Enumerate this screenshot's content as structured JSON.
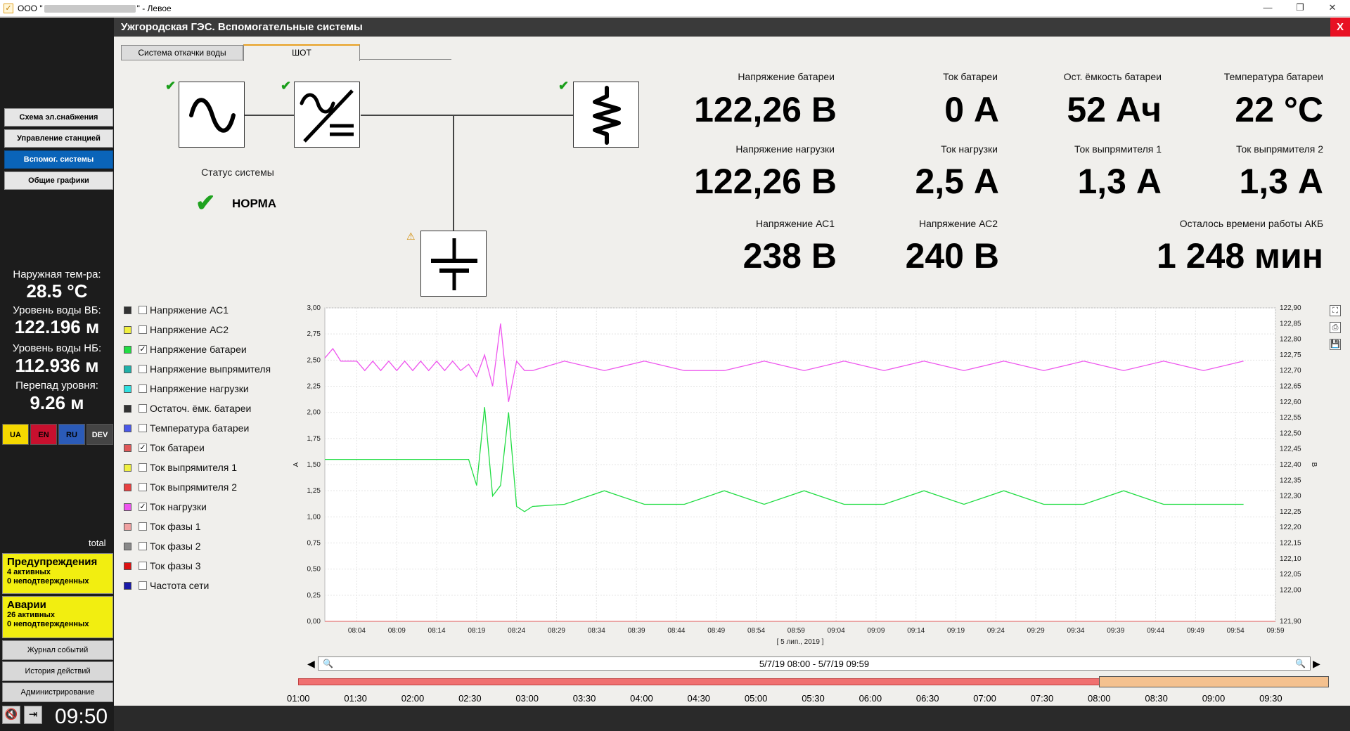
{
  "window": {
    "title_prefix": "ООО \"",
    "title_suffix": "\" - Левое",
    "minimize": "—",
    "maximize": "❐",
    "close": "✕"
  },
  "nav": [
    {
      "label": "Схема эл.снабжения",
      "active": false
    },
    {
      "label": "Управление станцией",
      "active": false
    },
    {
      "label": "Вспомог. системы",
      "active": true
    },
    {
      "label": "Общие графики",
      "active": false
    }
  ],
  "params": {
    "outside_temp_label": "Наружная тем-ра:",
    "outside_temp": "28.5 °C",
    "water_vb_label": "Уровень воды ВБ:",
    "water_vb": "122.196 м",
    "water_nb_label": "Уровень воды НБ:",
    "water_nb": "112.936 м",
    "diff_label": "Перепад уровня:",
    "diff": "9.26 м"
  },
  "languages": [
    {
      "code": "UA",
      "color": "#f5d800"
    },
    {
      "code": "EN",
      "color": "#c8102e"
    },
    {
      "code": "RU",
      "color": "#2b5bb8"
    },
    {
      "code": "DEV",
      "color": "#444444"
    }
  ],
  "total_label": "total",
  "warnings": {
    "title": "Предупреждения",
    "active": "4 активных",
    "unconfirmed": "0 неподтвержденных"
  },
  "alarms": {
    "title": "Аварии",
    "active": "26 активных",
    "unconfirmed": "0 неподтвержденных"
  },
  "bottom_buttons": [
    "Журнал событий",
    "История действий",
    "Администрирование"
  ],
  "clock": "09:50",
  "main_title": "Ужгородская ГЭС. Вспомогательные системы",
  "close_label": "X",
  "tabs": [
    {
      "label": "Система откачки воды",
      "active": false
    },
    {
      "label": "ШОТ",
      "active": true
    }
  ],
  "system_status": {
    "label": "Статус системы",
    "value": "НОРМА"
  },
  "readouts": {
    "battery_voltage": {
      "label": "Напряжение батареи",
      "value": "122,26 В"
    },
    "battery_current": {
      "label": "Ток батареи",
      "value": "0 А"
    },
    "battery_capacity": {
      "label": "Ост. ёмкость батареи",
      "value": "52 Ач"
    },
    "battery_temp": {
      "label": "Температура батареи",
      "value": "22 °С"
    },
    "load_voltage": {
      "label": "Напряжение нагрузки",
      "value": "122,26 В"
    },
    "load_current": {
      "label": "Ток нагрузки",
      "value": "2,5 А"
    },
    "rect1_current": {
      "label": "Ток выпрямителя 1",
      "value": "1,3 А"
    },
    "rect2_current": {
      "label": "Ток выпрямителя 2",
      "value": "1,3 А"
    },
    "ac1_voltage": {
      "label": "Напряжение АС1",
      "value": "238 В"
    },
    "ac2_voltage": {
      "label": "Напряжение АС2",
      "value": "240 В"
    },
    "runtime_left": {
      "label": "Осталось времени работы АКБ",
      "value": "1 248 мин"
    }
  },
  "legend": [
    {
      "label": "Напряжение АС1",
      "color": "#333333",
      "checked": false
    },
    {
      "label": "Напряжение АС2",
      "color": "#f0f040",
      "checked": false
    },
    {
      "label": "Напряжение батареи",
      "color": "#22dd44",
      "checked": true
    },
    {
      "label": "Напряжение выпрямителя",
      "color": "#20b0a8",
      "checked": false
    },
    {
      "label": "Напряжение нагрузки",
      "color": "#30e0e0",
      "checked": false
    },
    {
      "label": "Остаточ. ёмк. батареи",
      "color": "#333333",
      "checked": false
    },
    {
      "label": "Температура батареи",
      "color": "#4a58e8",
      "checked": false
    },
    {
      "label": "Ток батареи",
      "color": "#e05858",
      "checked": true
    },
    {
      "label": "Ток выпрямителя 1",
      "color": "#f0f040",
      "checked": false
    },
    {
      "label": "Ток выпрямителя 2",
      "color": "#e84040",
      "checked": false
    },
    {
      "label": "Ток нагрузки",
      "color": "#ee55ee",
      "checked": true
    },
    {
      "label": "Ток фазы 1",
      "color": "#f0a0a0",
      "checked": false
    },
    {
      "label": "Ток фазы 2",
      "color": "#888888",
      "checked": false
    },
    {
      "label": "Ток фазы 3",
      "color": "#dd1111",
      "checked": false
    },
    {
      "label": "Частота сети",
      "color": "#1a1aa8",
      "checked": false
    }
  ],
  "chart_data": {
    "type": "line",
    "x_ticks": [
      "08:04",
      "08:09",
      "08:14",
      "08:19",
      "08:24",
      "08:29",
      "08:34",
      "08:39",
      "08:44",
      "08:49",
      "08:54",
      "08:59",
      "09:04",
      "09:09",
      "09:14",
      "09:19",
      "09:24",
      "09:29",
      "09:34",
      "09:39",
      "09:44",
      "09:49",
      "09:54",
      "09:59"
    ],
    "xlabel": "[ 5 лип., 2019 ]",
    "ylabel": "А",
    "ylabel_right": "В",
    "ylim": [
      0,
      3.0
    ],
    "ylim_right": [
      121.9,
      122.9
    ],
    "y_ticks": [
      "0,00",
      "0,25",
      "0,50",
      "0,75",
      "1,00",
      "1,25",
      "1,50",
      "1,75",
      "2,00",
      "2,25",
      "2,50",
      "2,75",
      "3,00"
    ],
    "y_ticks_right": [
      "121,90",
      "122,00",
      "122,05",
      "122,10",
      "122,15",
      "122,20",
      "122,25",
      "122,30",
      "122,35",
      "122,40",
      "122,45",
      "122,50",
      "122,55",
      "122,60",
      "122,65",
      "122,70",
      "122,75",
      "122,80",
      "122,85",
      "122,90"
    ],
    "series": [
      {
        "color": "#ee55ee",
        "axis": "right",
        "x": [
          "08:00",
          "08:01",
          "08:02",
          "08:03",
          "08:04",
          "08:05",
          "08:06",
          "08:07",
          "08:08",
          "08:09",
          "08:10",
          "08:11",
          "08:12",
          "08:13",
          "08:14",
          "08:15",
          "08:16",
          "08:17",
          "08:18",
          "08:19",
          "08:20",
          "08:21",
          "08:22",
          "08:23",
          "08:24",
          "08:25",
          "08:26",
          "08:30",
          "08:35",
          "08:40",
          "08:45",
          "08:50",
          "08:55",
          "09:00",
          "09:05",
          "09:10",
          "09:15",
          "09:20",
          "09:25",
          "09:30",
          "09:35",
          "09:40",
          "09:45",
          "09:50",
          "09:55"
        ],
        "values": [
          122.74,
          122.77,
          122.73,
          122.73,
          122.73,
          122.7,
          122.73,
          122.7,
          122.73,
          122.7,
          122.73,
          122.7,
          122.73,
          122.7,
          122.73,
          122.7,
          122.73,
          122.7,
          122.72,
          122.68,
          122.75,
          122.65,
          122.85,
          122.6,
          122.73,
          122.7,
          122.7,
          122.73,
          122.7,
          122.73,
          122.7,
          122.7,
          122.73,
          122.7,
          122.73,
          122.7,
          122.73,
          122.7,
          122.73,
          122.7,
          122.73,
          122.7,
          122.73,
          122.7,
          122.73
        ]
      },
      {
        "color": "#22dd44",
        "axis": "left",
        "x": [
          "08:00",
          "08:05",
          "08:10",
          "08:15",
          "08:18",
          "08:19",
          "08:20",
          "08:21",
          "08:22",
          "08:23",
          "08:24",
          "08:25",
          "08:26",
          "08:30",
          "08:35",
          "08:40",
          "08:45",
          "08:50",
          "08:55",
          "09:00",
          "09:05",
          "09:10",
          "09:15",
          "09:20",
          "09:25",
          "09:30",
          "09:35",
          "09:40",
          "09:45",
          "09:50",
          "09:55"
        ],
        "values": [
          1.55,
          1.55,
          1.55,
          1.55,
          1.55,
          1.3,
          2.05,
          1.2,
          1.3,
          2.0,
          1.1,
          1.05,
          1.1,
          1.12,
          1.25,
          1.12,
          1.12,
          1.25,
          1.12,
          1.25,
          1.12,
          1.12,
          1.25,
          1.12,
          1.25,
          1.12,
          1.12,
          1.25,
          1.12,
          1.12,
          1.12
        ]
      }
    ]
  },
  "range_text": "5/7/19 08:00 - 5/7/19 09:59",
  "overview_ticks": [
    "01:00",
    "01:30",
    "02:00",
    "02:30",
    "03:00",
    "03:30",
    "04:00",
    "04:30",
    "05:00",
    "05:30",
    "06:00",
    "06:30",
    "07:00",
    "07:30",
    "08:00",
    "08:30",
    "09:00",
    "09:30"
  ],
  "chart_tools": [
    "⛶",
    "⎙",
    "💾"
  ]
}
